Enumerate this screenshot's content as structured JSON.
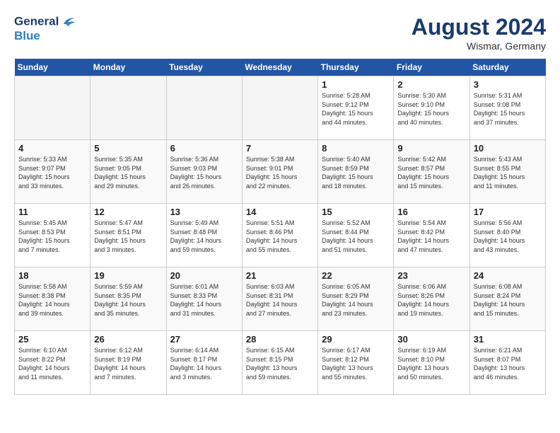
{
  "header": {
    "logo_line1": "General",
    "logo_line2": "Blue",
    "month_year": "August 2024",
    "location": "Wismar, Germany"
  },
  "weekdays": [
    "Sunday",
    "Monday",
    "Tuesday",
    "Wednesday",
    "Thursday",
    "Friday",
    "Saturday"
  ],
  "weeks": [
    [
      {
        "day": "",
        "info": "",
        "empty": true
      },
      {
        "day": "",
        "info": "",
        "empty": true
      },
      {
        "day": "",
        "info": "",
        "empty": true
      },
      {
        "day": "",
        "info": "",
        "empty": true
      },
      {
        "day": "1",
        "info": "Sunrise: 5:28 AM\nSunset: 9:12 PM\nDaylight: 15 hours\nand 44 minutes.",
        "empty": false
      },
      {
        "day": "2",
        "info": "Sunrise: 5:30 AM\nSunset: 9:10 PM\nDaylight: 15 hours\nand 40 minutes.",
        "empty": false
      },
      {
        "day": "3",
        "info": "Sunrise: 5:31 AM\nSunset: 9:08 PM\nDaylight: 15 hours\nand 37 minutes.",
        "empty": false
      }
    ],
    [
      {
        "day": "4",
        "info": "Sunrise: 5:33 AM\nSunset: 9:07 PM\nDaylight: 15 hours\nand 33 minutes.",
        "empty": false
      },
      {
        "day": "5",
        "info": "Sunrise: 5:35 AM\nSunset: 9:05 PM\nDaylight: 15 hours\nand 29 minutes.",
        "empty": false
      },
      {
        "day": "6",
        "info": "Sunrise: 5:36 AM\nSunset: 9:03 PM\nDaylight: 15 hours\nand 26 minutes.",
        "empty": false
      },
      {
        "day": "7",
        "info": "Sunrise: 5:38 AM\nSunset: 9:01 PM\nDaylight: 15 hours\nand 22 minutes.",
        "empty": false
      },
      {
        "day": "8",
        "info": "Sunrise: 5:40 AM\nSunset: 8:59 PM\nDaylight: 15 hours\nand 18 minutes.",
        "empty": false
      },
      {
        "day": "9",
        "info": "Sunrise: 5:42 AM\nSunset: 8:57 PM\nDaylight: 15 hours\nand 15 minutes.",
        "empty": false
      },
      {
        "day": "10",
        "info": "Sunrise: 5:43 AM\nSunset: 8:55 PM\nDaylight: 15 hours\nand 11 minutes.",
        "empty": false
      }
    ],
    [
      {
        "day": "11",
        "info": "Sunrise: 5:45 AM\nSunset: 8:53 PM\nDaylight: 15 hours\nand 7 minutes.",
        "empty": false
      },
      {
        "day": "12",
        "info": "Sunrise: 5:47 AM\nSunset: 8:51 PM\nDaylight: 15 hours\nand 3 minutes.",
        "empty": false
      },
      {
        "day": "13",
        "info": "Sunrise: 5:49 AM\nSunset: 8:48 PM\nDaylight: 14 hours\nand 59 minutes.",
        "empty": false
      },
      {
        "day": "14",
        "info": "Sunrise: 5:51 AM\nSunset: 8:46 PM\nDaylight: 14 hours\nand 55 minutes.",
        "empty": false
      },
      {
        "day": "15",
        "info": "Sunrise: 5:52 AM\nSunset: 8:44 PM\nDaylight: 14 hours\nand 51 minutes.",
        "empty": false
      },
      {
        "day": "16",
        "info": "Sunrise: 5:54 AM\nSunset: 8:42 PM\nDaylight: 14 hours\nand 47 minutes.",
        "empty": false
      },
      {
        "day": "17",
        "info": "Sunrise: 5:56 AM\nSunset: 8:40 PM\nDaylight: 14 hours\nand 43 minutes.",
        "empty": false
      }
    ],
    [
      {
        "day": "18",
        "info": "Sunrise: 5:58 AM\nSunset: 8:38 PM\nDaylight: 14 hours\nand 39 minutes.",
        "empty": false
      },
      {
        "day": "19",
        "info": "Sunrise: 5:59 AM\nSunset: 8:35 PM\nDaylight: 14 hours\nand 35 minutes.",
        "empty": false
      },
      {
        "day": "20",
        "info": "Sunrise: 6:01 AM\nSunset: 8:33 PM\nDaylight: 14 hours\nand 31 minutes.",
        "empty": false
      },
      {
        "day": "21",
        "info": "Sunrise: 6:03 AM\nSunset: 8:31 PM\nDaylight: 14 hours\nand 27 minutes.",
        "empty": false
      },
      {
        "day": "22",
        "info": "Sunrise: 6:05 AM\nSunset: 8:29 PM\nDaylight: 14 hours\nand 23 minutes.",
        "empty": false
      },
      {
        "day": "23",
        "info": "Sunrise: 6:06 AM\nSunset: 8:26 PM\nDaylight: 14 hours\nand 19 minutes.",
        "empty": false
      },
      {
        "day": "24",
        "info": "Sunrise: 6:08 AM\nSunset: 8:24 PM\nDaylight: 14 hours\nand 15 minutes.",
        "empty": false
      }
    ],
    [
      {
        "day": "25",
        "info": "Sunrise: 6:10 AM\nSunset: 8:22 PM\nDaylight: 14 hours\nand 11 minutes.",
        "empty": false
      },
      {
        "day": "26",
        "info": "Sunrise: 6:12 AM\nSunset: 8:19 PM\nDaylight: 14 hours\nand 7 minutes.",
        "empty": false
      },
      {
        "day": "27",
        "info": "Sunrise: 6:14 AM\nSunset: 8:17 PM\nDaylight: 14 hours\nand 3 minutes.",
        "empty": false
      },
      {
        "day": "28",
        "info": "Sunrise: 6:15 AM\nSunset: 8:15 PM\nDaylight: 13 hours\nand 59 minutes.",
        "empty": false
      },
      {
        "day": "29",
        "info": "Sunrise: 6:17 AM\nSunset: 8:12 PM\nDaylight: 13 hours\nand 55 minutes.",
        "empty": false
      },
      {
        "day": "30",
        "info": "Sunrise: 6:19 AM\nSunset: 8:10 PM\nDaylight: 13 hours\nand 50 minutes.",
        "empty": false
      },
      {
        "day": "31",
        "info": "Sunrise: 6:21 AM\nSunset: 8:07 PM\nDaylight: 13 hours\nand 46 minutes.",
        "empty": false
      }
    ]
  ]
}
